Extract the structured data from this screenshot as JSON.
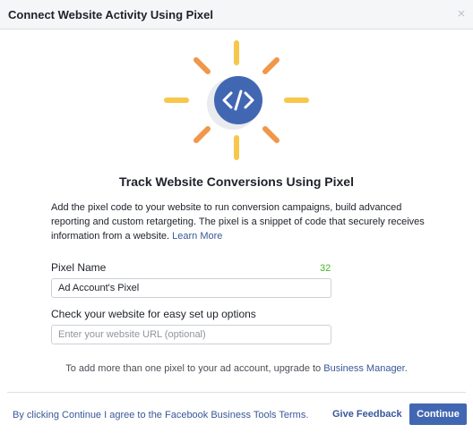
{
  "dialog": {
    "title": "Connect Website Activity Using Pixel",
    "close_glyph": "×"
  },
  "hero": {
    "icon": "code-brackets-icon",
    "glyph": "</>",
    "circle_color": "#4267b2",
    "ray_color_yellow": "#f7c74b",
    "ray_color_orange": "#f0974a"
  },
  "main": {
    "heading": "Track Website Conversions Using Pixel",
    "description": "Add the pixel code to your website to run conversion campaigns, build advanced reporting and custom retargeting. The pixel is a snippet of code that securely receives information from a website.",
    "learn_more": "Learn More",
    "pixel_name_label": "Pixel Name",
    "pixel_name_counter": "32",
    "pixel_name_value": "Ad Account's Pixel",
    "website_label": "Check your website for easy set up options",
    "website_placeholder": "Enter your website URL (optional)",
    "upgrade_text": "To add more than one pixel to your ad account, upgrade to",
    "upgrade_link": "Business Manager",
    "upgrade_suffix": "."
  },
  "footer": {
    "terms": "By clicking Continue I agree to the Facebook Business Tools Terms.",
    "feedback": "Give Feedback",
    "continue": "Continue"
  }
}
